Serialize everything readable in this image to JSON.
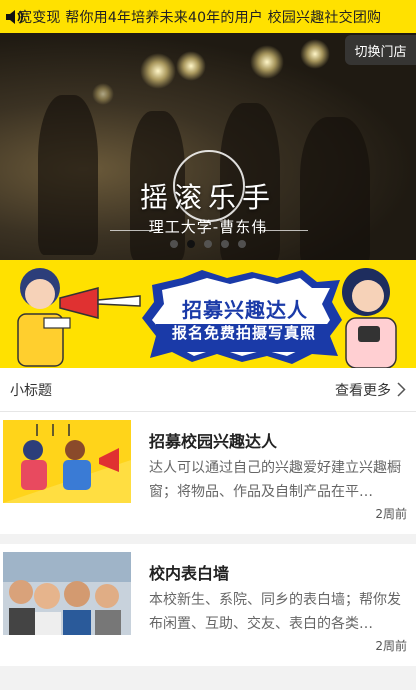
{
  "marquee": {
    "text": "宽变现 帮你用4年培养未来40年的用户   校园兴趣社交团购"
  },
  "hero": {
    "switch_store_label": "切换门店",
    "title": "摇滚乐手",
    "subtitle": "理工大学-曹东伟",
    "slide_count": 5,
    "active_slide": 2
  },
  "recruit": {
    "line1": "招募兴趣达人",
    "line2": "报名免费拍摄写真照"
  },
  "section": {
    "title": "小标题",
    "see_more": "查看更多"
  },
  "cards": [
    {
      "title": "招募校园兴趣达人",
      "desc": "达人可以通过自己的兴趣爱好建立兴趣橱窗；将物品、作品及自制产品在平…",
      "time": "2周前"
    },
    {
      "title": "校内表白墙",
      "desc": "本校新生、系院、同乡的表白墙；帮你发布闲置、互助、交友、表白的各类…",
      "time": "2周前"
    }
  ],
  "colors": {
    "accent_yellow": "#ffe100",
    "recruit_blue": "#1a3aa8"
  }
}
